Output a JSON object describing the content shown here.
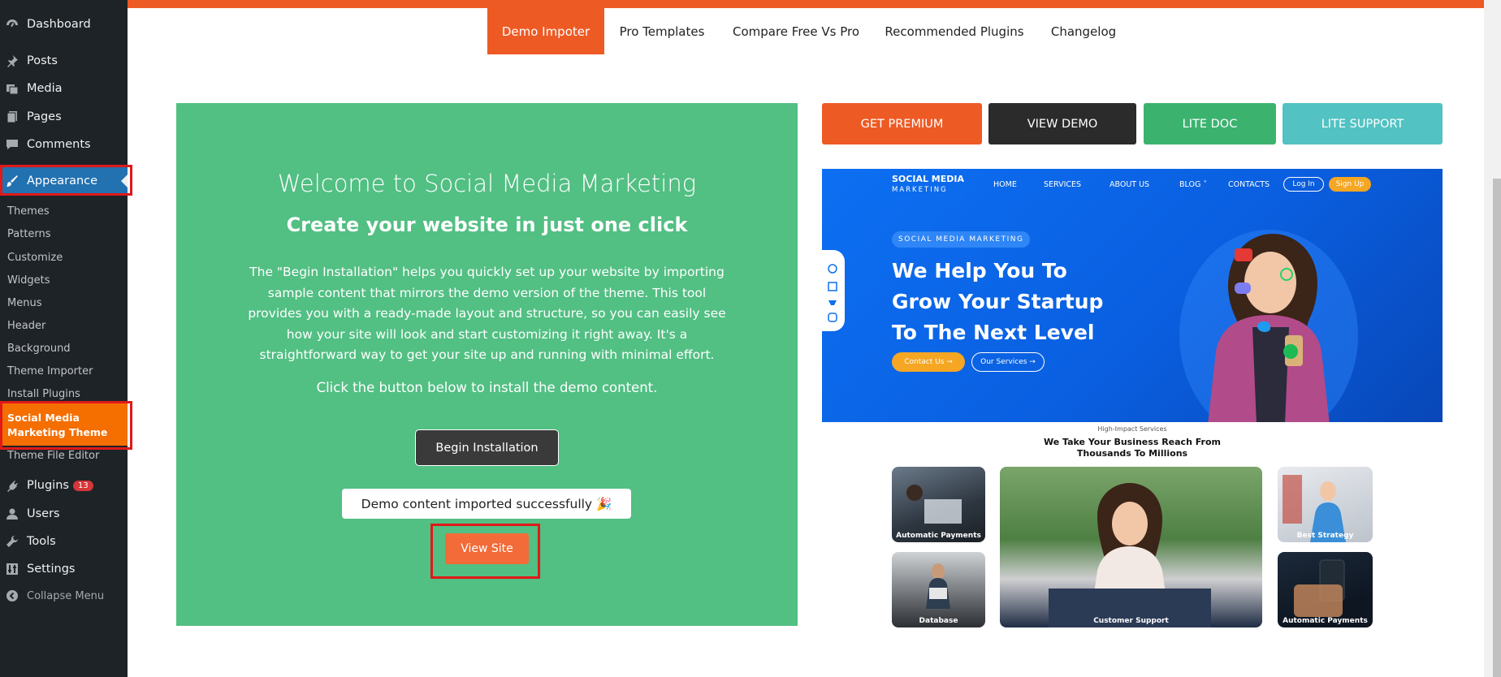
{
  "sidebar": {
    "dashboard": "Dashboard",
    "posts": "Posts",
    "media": "Media",
    "pages": "Pages",
    "comments": "Comments",
    "appearance": "Appearance",
    "submenu": [
      "Themes",
      "Patterns",
      "Customize",
      "Widgets",
      "Menus",
      "Header",
      "Background",
      "Theme Importer",
      "Install Plugins"
    ],
    "active_sub": "Social Media Marketing Theme",
    "theme_file_editor": "Theme File Editor",
    "plugins": "Plugins",
    "plugins_count": "13",
    "users": "Users",
    "tools": "Tools",
    "settings": "Settings",
    "collapse": "Collapse Menu"
  },
  "tabs": [
    "Demo Impoter",
    "Pro Templates",
    "Compare Free Vs Pro",
    "Recommended Plugins",
    "Changelog"
  ],
  "panel": {
    "title": "Welcome to Social Media Marketing",
    "subtitle": "Create your website in just one click",
    "description": "The \"Begin Installation\" helps you quickly set up your website by importing sample content that mirrors the demo version of the theme. This tool provides you with a ready-made layout and structure, so you can easily see how your site will look and start customizing it right away. It's a straightforward way to get your site up and running with minimal effort.",
    "instruction": "Click the button below to install the demo content.",
    "begin_button": "Begin Installation",
    "success_message": "Demo content imported successfully 🎉",
    "view_site_button": "View Site"
  },
  "actions": {
    "premium": "GET PREMIUM",
    "demo": "VIEW DEMO",
    "doc": "LITE DOC",
    "support": "LITE SUPPORT"
  },
  "preview": {
    "logo_top": "SOCIAL MEDIA",
    "logo_bottom": "MARKETING",
    "nav": [
      "HOME",
      "SERVICES",
      "ABOUT US",
      "BLOG ˅",
      "CONTACTS"
    ],
    "login": "Log In",
    "signup": "Sign Up",
    "badge": "SOCIAL MEDIA MARKETING",
    "headline": [
      "We Help You To",
      "Grow Your Startup",
      "To The Next Level"
    ],
    "contact_btn": "Contact Us →",
    "services_btn": "Our Services →",
    "section_kicker": "High-Impact Services",
    "section_title": [
      "We Take Your Business Reach From",
      "Thousands To Millions"
    ],
    "cards": [
      "Automatic Payments",
      "Customer Support",
      "Best Strategy",
      "Database",
      "Automatic Payments"
    ]
  },
  "colors": {
    "accent_orange": "#ee5a24",
    "panel_green": "#52bf83",
    "wp_blue": "#2271b1",
    "highlight_red": "#e01919"
  }
}
